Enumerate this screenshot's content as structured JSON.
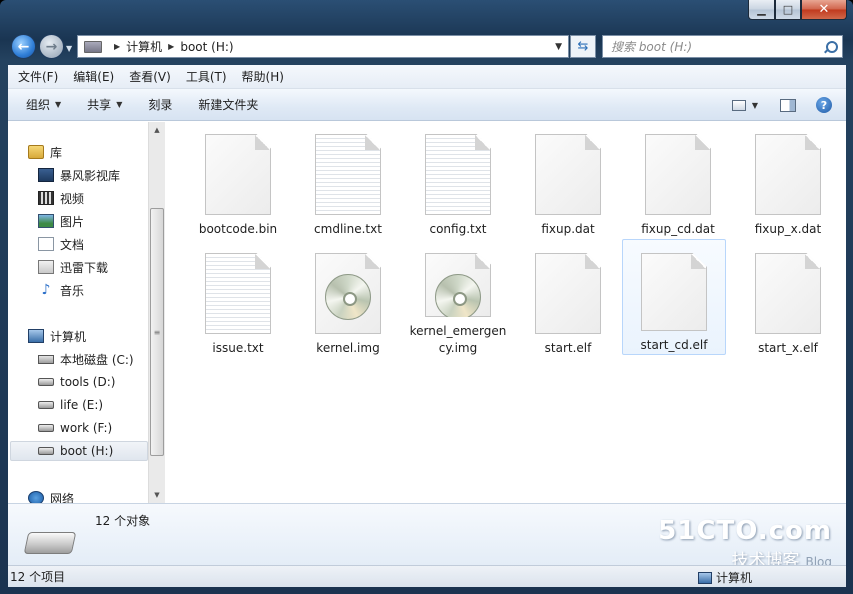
{
  "address": {
    "segments": [
      "计算机",
      "boot (H:)"
    ]
  },
  "search": {
    "placeholder": "搜索 boot (H:)"
  },
  "menu": [
    "文件(F)",
    "编辑(E)",
    "查看(V)",
    "工具(T)",
    "帮助(H)"
  ],
  "toolbar": {
    "organize": "组织",
    "share": "共享",
    "burn": "刻录",
    "new_folder": "新建文件夹"
  },
  "navpane": {
    "libraries": {
      "label": "库",
      "items": [
        "暴风影视库",
        "视频",
        "图片",
        "文档",
        "迅雷下载",
        "音乐"
      ]
    },
    "computer": {
      "label": "计算机",
      "items": [
        "本地磁盘 (C:)",
        "tools (D:)",
        "life (E:)",
        "work (F:)",
        "boot (H:)"
      ],
      "selected": "boot (H:)"
    },
    "network": {
      "label": "网络"
    }
  },
  "files": [
    {
      "name": "bootcode.bin",
      "icon": "blank-file-icon"
    },
    {
      "name": "cmdline.txt",
      "icon": "text-file-icon"
    },
    {
      "name": "config.txt",
      "icon": "text-file-icon"
    },
    {
      "name": "fixup.dat",
      "icon": "blank-file-icon"
    },
    {
      "name": "fixup_cd.dat",
      "icon": "blank-file-icon"
    },
    {
      "name": "fixup_x.dat",
      "icon": "blank-file-icon"
    },
    {
      "name": "issue.txt",
      "icon": "text-file-icon"
    },
    {
      "name": "kernel.img",
      "icon": "disc-image-icon"
    },
    {
      "name": "kernel_emergency.img",
      "icon": "disc-image-icon"
    },
    {
      "name": "start.elf",
      "icon": "blank-file-icon"
    },
    {
      "name": "start_cd.elf",
      "icon": "blank-file-icon",
      "selected": true
    },
    {
      "name": "start_x.elf",
      "icon": "blank-file-icon"
    }
  ],
  "details": {
    "count_text": "12 个对象"
  },
  "status": {
    "left": "12 个项目",
    "right": "计算机"
  },
  "watermark": {
    "brand": "51CTO.com",
    "tagline": "技术博客",
    "blog": "Blog"
  }
}
